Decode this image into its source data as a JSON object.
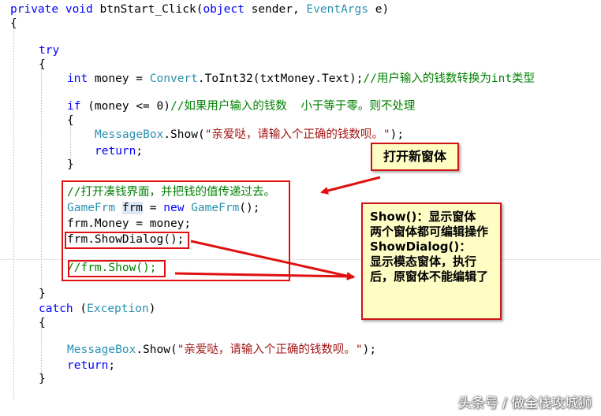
{
  "code": {
    "signature": {
      "private": "private",
      "void": "void",
      "name": " btnStart_Click(",
      "object": "object",
      "sender": " sender, ",
      "event_args": "EventArgs",
      "param_e": " e)"
    },
    "open_brace": "{",
    "close_brace": "}",
    "try_keyword": "try",
    "catch_keyword": "catch",
    "catch_open": " (",
    "exception_type": "Exception",
    "catch_close": ")",
    "int_keyword": "int",
    "money_assign": " money = ",
    "convert_type": "Convert",
    "to_int32_call": ".ToInt32(txtMoney.Text);",
    "comment_convert": "//用户输入的钱数转换为int类型",
    "if_keyword": "if",
    "if_condition": " (money <= 0)",
    "comment_if": "//如果用户输入的钱数  小于等于零。则不处理",
    "messagebox_type": "MessageBox",
    "show_open": ".Show(",
    "message_text": "\"亲爱哒，请输入个正确的钱数呗。\"",
    "show_close": ");",
    "return_keyword": "return",
    "semicolon": ";",
    "comment_open_form": "//打开凑钱界面，并把钱的值传递过去。",
    "gamefrm_type": "GameFrm",
    "frm_var": "frm",
    "assign_op": " = ",
    "new_keyword": "new",
    "ctor_tail": "();",
    "money_line": "frm.Money = money;",
    "showdialog_line": "frm.ShowDialog();",
    "comment_show": "//frm.Show();"
  },
  "callouts": {
    "title": "打开新窗体",
    "note_lines": [
      "Show()：显示窗体",
      "两个窗体都可编辑操作",
      "ShowDialog()：",
      "显示模态窗体，执行后，原窗体不能编辑了"
    ]
  },
  "watermark": "头条号 / 做全栈攻城狮",
  "colors": {
    "keyword": "#0000ff",
    "type": "#2b91af",
    "comment": "#008000",
    "string": "#a31515",
    "annotation_red": "#e01010",
    "callout_fill": "#fdfdc4"
  }
}
